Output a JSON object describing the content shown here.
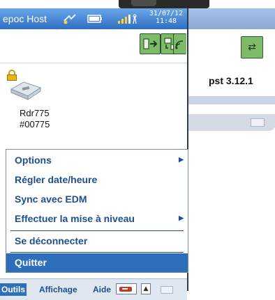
{
  "window": {
    "title": "epoc Host",
    "clock_date": "31/07/12",
    "clock_time": "11:48"
  },
  "background_window": {
    "version_text": "pst 3.12.1"
  },
  "reader": {
    "name": "Rdr775",
    "id": "#00775"
  },
  "context_menu": {
    "items": [
      {
        "label": "Options",
        "has_submenu": true
      },
      {
        "label": "Régler date/heure",
        "has_submenu": false
      },
      {
        "label": "Sync avec EDM",
        "has_submenu": false
      },
      {
        "label": "Effectuer la mise à niveau",
        "has_submenu": true
      },
      {
        "label": "Se déconnecter",
        "has_submenu": false
      },
      {
        "label": "Quitter",
        "has_submenu": false
      }
    ],
    "selected": "Quitter"
  },
  "menubar": {
    "outils": "Outils",
    "affichage": "Affichage",
    "aide": "Aide"
  },
  "icons": {
    "title_bar": [
      "bluetooth-sync-icon",
      "battery-icon",
      "signal-antenna-icon"
    ],
    "toolbar": [
      "exit-reader-icon",
      "sync-icon",
      "wireless-search-icon"
    ],
    "menubar": [
      "card-reader-icon",
      "up-arrow-icon",
      "keyboard-icon"
    ]
  },
  "colors": {
    "title_bar": "#2f6fc2",
    "menu_text": "#1f4e8c",
    "selection": "#2d6fb9",
    "toolbar_icon": "#7dbb6b"
  }
}
